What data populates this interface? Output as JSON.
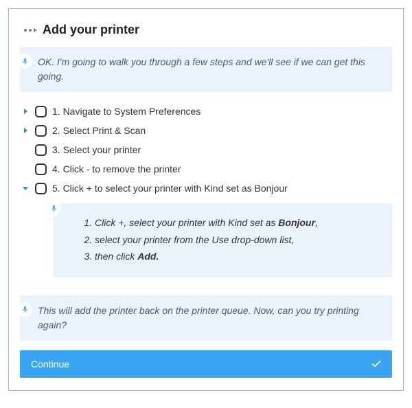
{
  "title": "Add your printer",
  "intro": "OK. I'm going to walk you through a few steps and we'll see if we can get this going.",
  "steps": [
    {
      "label": "1. Navigate to System Preferences",
      "expandable": true,
      "expanded": false
    },
    {
      "label": "2. Select Print & Scan",
      "expandable": true,
      "expanded": false
    },
    {
      "label": "3. Select your printer",
      "expandable": false,
      "expanded": false
    },
    {
      "label": "4. Click - to remove the printer",
      "expandable": false,
      "expanded": false
    },
    {
      "label": "5. Click + to select your printer with Kind set as Bonjour",
      "expandable": true,
      "expanded": true
    }
  ],
  "substep_html": [
    "Click +, select your printer with Kind set as <b>Bonjour</b>,",
    "select your printer from the Use drop-down list,",
    "then click <b>Add.</b>"
  ],
  "outro": "This will add the printer back on the printer queue. Now, can you try printing again?",
  "continue_label": "Continue",
  "colors": {
    "accent": "#39a5f2",
    "bubble": "#eaf2fb",
    "border": "#9ab6d8"
  }
}
